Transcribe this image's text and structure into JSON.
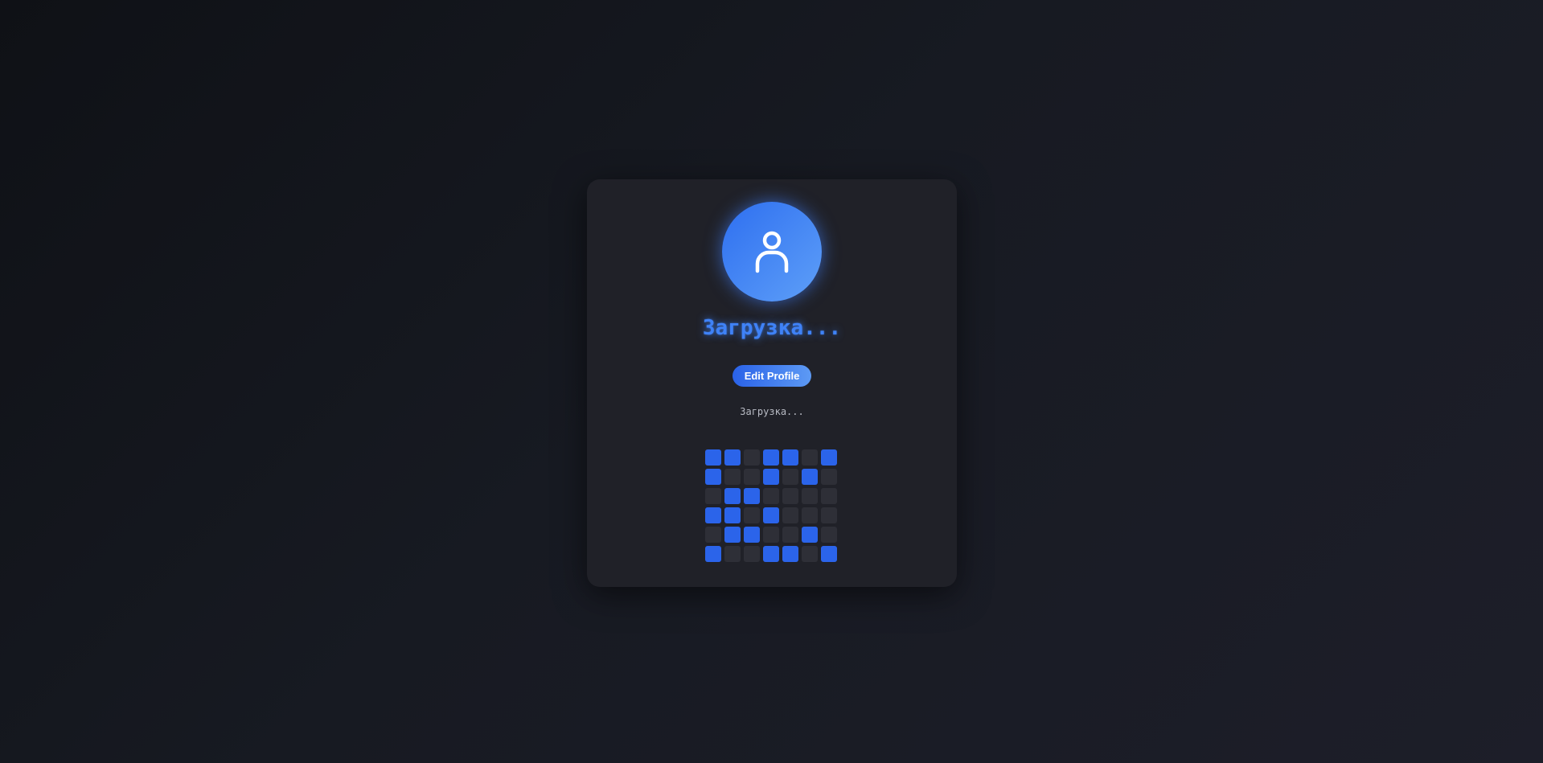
{
  "profile": {
    "avatar_icon": "user-icon",
    "title": "Загрузка...",
    "edit_button_label": "Edit Profile",
    "status_text": "Загрузка..."
  },
  "identicon": {
    "rows": 6,
    "cols": 7,
    "on_color": "#2b64ea",
    "off_color": "#2e2f37",
    "pattern": [
      [
        1,
        1,
        0,
        1,
        1,
        0,
        1
      ],
      [
        1,
        0,
        0,
        1,
        0,
        1,
        0
      ],
      [
        0,
        1,
        1,
        0,
        0,
        0,
        0
      ],
      [
        1,
        1,
        0,
        1,
        0,
        0,
        0
      ],
      [
        0,
        1,
        1,
        0,
        0,
        1,
        0
      ],
      [
        1,
        0,
        0,
        1,
        1,
        0,
        1
      ]
    ]
  },
  "colors": {
    "accent": "#3f82f7",
    "card_bg": "#202128"
  }
}
